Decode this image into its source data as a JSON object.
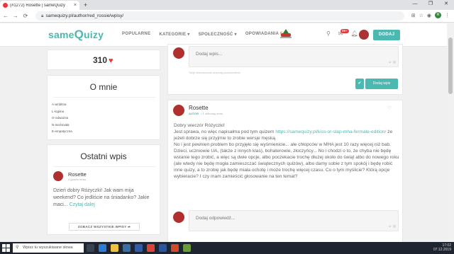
{
  "browser": {
    "tab_title": "(#1272) Rosette | sameQuizy",
    "tab_close": "×",
    "new_tab": "+",
    "url": "samequizy.pl/author/red_rossie/wpisy/",
    "window_controls": [
      "—",
      "❐",
      "✕"
    ],
    "profile_initial": "R"
  },
  "header": {
    "logo_same": "same",
    "logo_q": "Q",
    "logo_rest": "uizy",
    "nav": [
      "POPULARNE",
      "KATEGORIE ▾",
      "SPOŁECZNOŚĆ ▾",
      "OPOWIADANIA"
    ],
    "nav_badge": "6",
    "notif_count": "99+",
    "add_button": "DODAJ"
  },
  "sidebar": {
    "score": "310",
    "about_title": "O mnie",
    "about_lines": [
      "A-ambitna",
      "L-logiina",
      "O-odważna",
      "N-nieŚmiała",
      "E-empatyczna"
    ],
    "last_post_title": "Ostatni wpis",
    "last_post_author": "Rosette",
    "last_post_date": "4 godzin temu",
    "last_post_text": "Dzień dobry Różyczki! Jak wam mija weekend? Co jedliście na śniadanko? Jakie maci...",
    "last_post_more": "Czytaj dalej",
    "all_posts_button": "ZOBACZ WSZYSTKIE WPISY ➡"
  },
  "composer": {
    "placeholder": "Dodaj wpis...",
    "note": "Twoje obserwowania otrzymają powiadomienie.",
    "submit": "Dodaj wpis",
    "check": "✔"
  },
  "post": {
    "author": "Rosette",
    "role": "AUTOR",
    "time": "• 1 sekundę temu",
    "greeting": "Dobry wieczór Różyczki!",
    "intro": "Jest sprawa, no więc napisałma pod tym quizem",
    "link": "https://samequizy.pl/kiss-or-slap-mha-fermale-edition/",
    "intro_rest": "że jeżeli dobrze się przyjmie to zrobie wersje męską.",
    "body": "No i jest pewnien problem bo przyjęło się wyśmienicie... ale chłopców w MHA jest 10 razy więcej niż bab. Dzieci, uczniowie UA, (także z innych klas), bohaterowie, złoczyńcy... No i chodzi o to, że chyba nie będę wstanie tego zrobić, a więc są dwie opcje, albo poczekacie trochę dłużej około do świąt albo do nowego roku (ale wtedy nie będę mogła zamieszczać świątecznych quizów), albo damy sobie z tym spokój i będę robić inne quizy, a to zrobię jak będę miała ochotę i może trochę więcej czasu. Co o tym myślicie? Którą opcje wybieracie? I czy mam zamieścić głosowanie na ten temat?",
    "reply_placeholder": "Dodaj odpowiedź..."
  },
  "taskbar": {
    "search_placeholder": "Wpisz tu wyszukiwane słowa",
    "time": "17:02",
    "date": "07.12.2019"
  },
  "colors": {
    "brand": "#4cb8b2",
    "heart": "#e8383d",
    "taskbar": "#1f2530"
  }
}
